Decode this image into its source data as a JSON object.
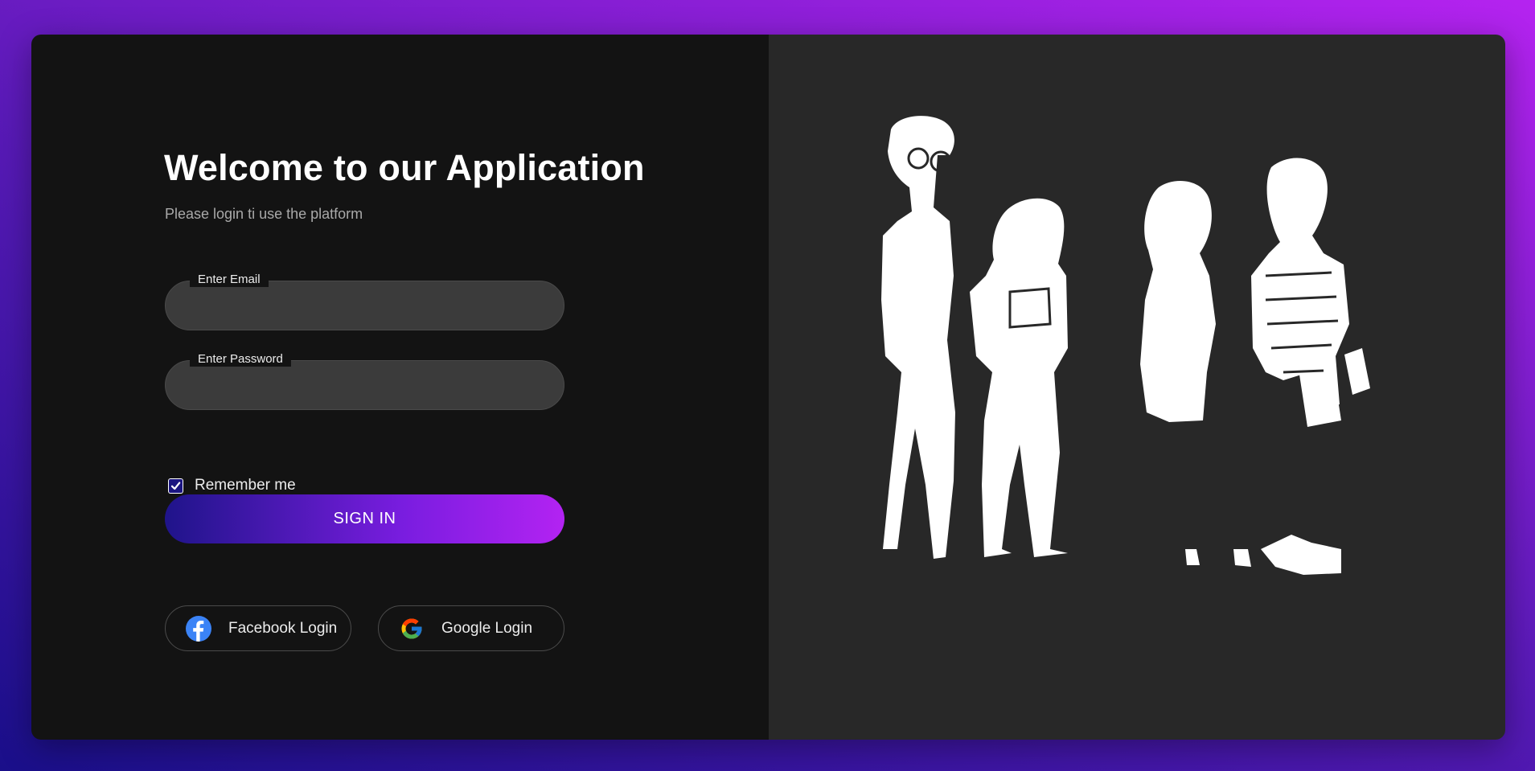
{
  "login": {
    "title": "Welcome to our Application",
    "subtitle": "Please login ti use the platform",
    "email": {
      "label": "Enter Email",
      "value": ""
    },
    "password": {
      "label": "Enter Password",
      "value": ""
    },
    "remember": {
      "label": "Remember me",
      "checked": true
    },
    "signin_label": "SIGN IN",
    "social": {
      "facebook_label": "Facebook Login",
      "google_label": "Google Login"
    }
  },
  "illustration": {
    "icon": "people-group-icon"
  },
  "colors": {
    "background_start": "#1a0f8a",
    "background_end": "#b523f0",
    "left_panel": "#131313",
    "right_panel": "#282828",
    "field": "#3b3b3b",
    "accent_start": "#1f148a",
    "accent_end": "#b323f2"
  }
}
